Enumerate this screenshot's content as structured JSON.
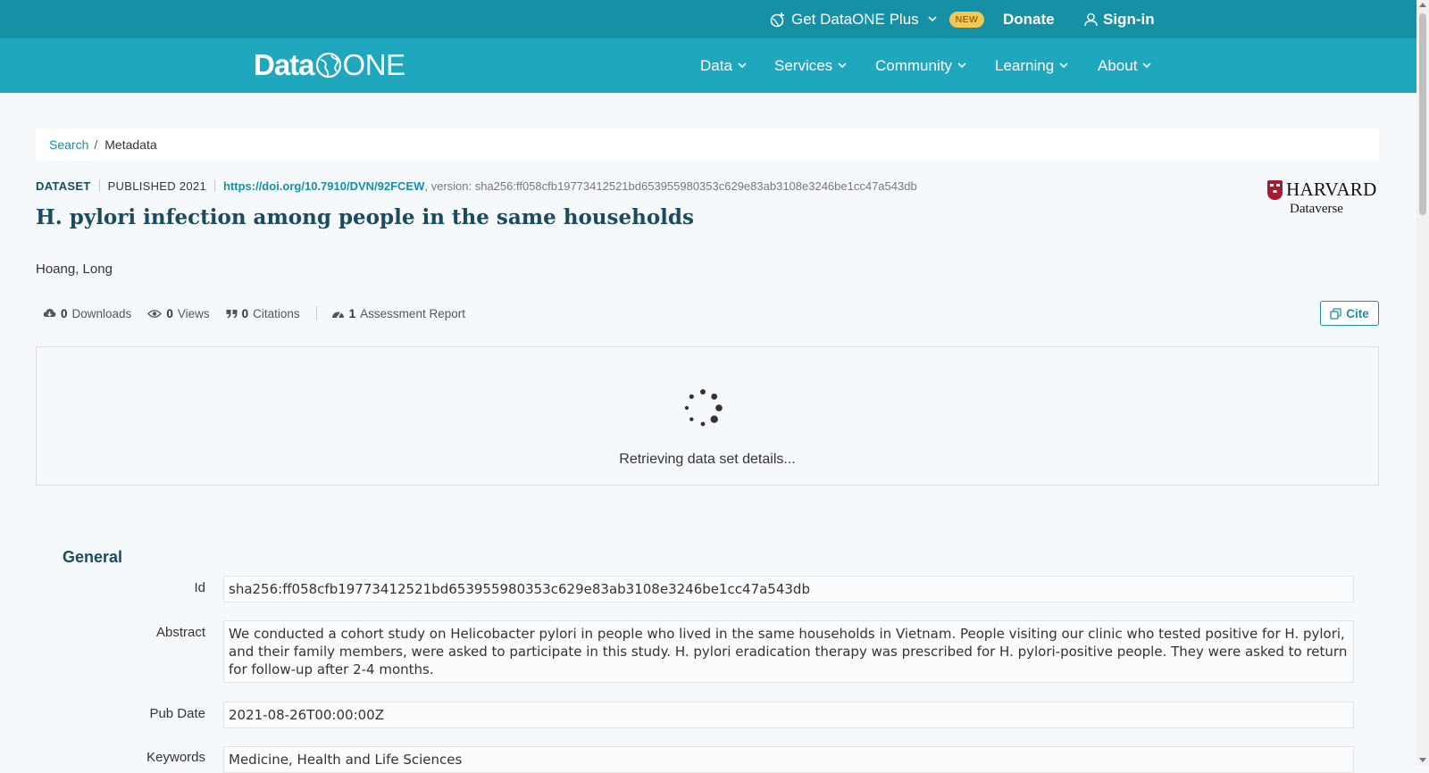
{
  "topbar": {
    "plus_label": "Get DataONE Plus",
    "new_badge": "NEW",
    "donate_label": "Donate",
    "signin_label": "Sign-in"
  },
  "logo": {
    "data": "Data",
    "one": "ONE"
  },
  "nav": {
    "items": [
      {
        "label": "Data"
      },
      {
        "label": "Services"
      },
      {
        "label": "Community"
      },
      {
        "label": "Learning"
      },
      {
        "label": "About"
      }
    ]
  },
  "breadcrumb": {
    "search": "Search",
    "separator": "/",
    "current": "Metadata"
  },
  "dataset": {
    "type": "DATASET",
    "published": "PUBLISHED 2021",
    "doi": "https://doi.org/10.7910/DVN/92FCEW",
    "version": ", version: sha256:ff058cfb19773412521bd653955980353c629e83ab3108e3246be1cc47a543db",
    "title": "H. pylori infection among people in the same households",
    "author": "Hoang, Long",
    "repository": {
      "name": "HARVARD",
      "sub": "Dataverse"
    }
  },
  "stats": {
    "downloads_count": "0",
    "downloads_label": "Downloads",
    "views_count": "0",
    "views_label": "Views",
    "citations_count": "0",
    "citations_label": "Citations",
    "assessment_count": "1",
    "assessment_label": "Assessment Report"
  },
  "cite_label": "Cite",
  "loading_text": "Retrieving data set details...",
  "general": {
    "title": "General",
    "fields": [
      {
        "label": "Id",
        "value": "sha256:ff058cfb19773412521bd653955980353c629e83ab3108e3246be1cc47a543db"
      },
      {
        "label": "Abstract",
        "value": "We conducted a cohort study on Helicobacter pylori in people who lived in the same households in Vietnam. People visiting our clinic who tested positive for H. pylori, and their family members, were asked to participate in this study. H. pylori eradication therapy was prescribed for H. pylori-positive people. They were asked to return for follow-up after 2-4 months."
      },
      {
        "label": "Pub Date",
        "value": "2021-08-26T00:00:00Z"
      },
      {
        "label": "Keywords",
        "value": "Medicine, Health and Life Sciences"
      }
    ]
  },
  "colors": {
    "topbar": "#1590a5",
    "navbar": "#1fa7bd",
    "accent": "#1a8fa5",
    "heading": "#1a4b5e",
    "badge": "#f4c84f"
  }
}
